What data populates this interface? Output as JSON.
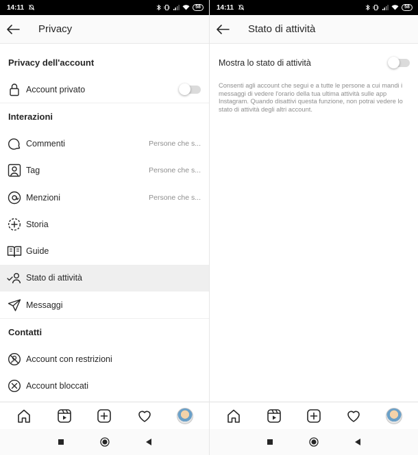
{
  "status": {
    "time": "14:11",
    "battery": "58"
  },
  "left": {
    "title": "Privacy",
    "sections": {
      "account": "Privacy dell'account",
      "interactions": "Interazioni",
      "contacts": "Contatti"
    },
    "account_private": "Account privato",
    "items": [
      {
        "label": "Commenti",
        "value": "Persone che s..."
      },
      {
        "label": "Tag",
        "value": "Persone che s..."
      },
      {
        "label": "Menzioni",
        "value": "Persone che s..."
      },
      {
        "label": "Storia",
        "value": ""
      },
      {
        "label": "Guide",
        "value": ""
      },
      {
        "label": "Stato di attività",
        "value": ""
      },
      {
        "label": "Messaggi",
        "value": ""
      }
    ],
    "contacts_items": [
      {
        "label": "Account con restrizioni"
      },
      {
        "label": "Account bloccati"
      }
    ]
  },
  "right": {
    "title": "Stato di attività",
    "toggle_label": "Mostra lo stato di attività",
    "description": "Consenti agli account che segui e a tutte le persone a cui mandi i messaggi di vedere l'orario della tua ultima attività sulle app Instagram. Quando disattivi questa funzione, non potrai vedere lo stato di attività degli altri account."
  },
  "icons": {
    "tabbar": [
      "home-icon",
      "reels-icon",
      "new-post-icon",
      "activity-heart-icon",
      "profile-avatar"
    ],
    "navbar": [
      "recents-icon",
      "home-circle-icon",
      "back-triangle-icon"
    ]
  },
  "colors": {
    "text": "#262626",
    "secondary": "#8e8e8e",
    "highlight": "#efefef",
    "toggle_off": "#dbdbdb"
  }
}
